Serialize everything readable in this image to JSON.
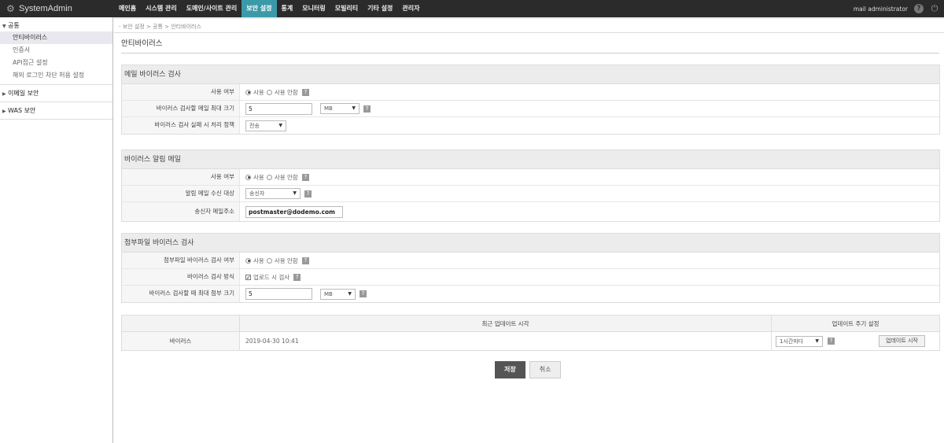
{
  "app": {
    "title": "SystemAdmin"
  },
  "topmenu": [
    "메인홈",
    "시스템 관리",
    "도메인/사이트 관리",
    "보안 설정",
    "통계",
    "모니터링",
    "모빌리티",
    "기타 설정",
    "관리자"
  ],
  "user": {
    "name": "mail administrator"
  },
  "sidebar": {
    "group1": {
      "label": "공통",
      "items": [
        "안티바이러스",
        "인증서",
        "API접근 설정",
        "해외 로그인 차단 허용 설정"
      ]
    },
    "group2": {
      "label": "이메일 보안"
    },
    "group3": {
      "label": "WAS 보안"
    }
  },
  "breadcrumb": "- 보안 설정 > 공통 > 안티바이러스",
  "page_title": "안티바이러스",
  "sec1": {
    "title": "메일 바이러스 검사",
    "r1": {
      "label": "사용 여부",
      "on": "사용",
      "off": "사용 안함"
    },
    "r2": {
      "label": "바이러스 검사할 메일 최대 크기",
      "value": "5",
      "unit": "MB"
    },
    "r3": {
      "label": "바이러스 검사 실패 시 처리 정책",
      "value": "전송"
    }
  },
  "sec2": {
    "title": "바이러스 알림 메일",
    "r1": {
      "label": "사용 여부",
      "on": "사용",
      "off": "사용 안함"
    },
    "r2": {
      "label": "알림 메일 수신 대상",
      "value": "송신자"
    },
    "r3": {
      "label": "송신자 메일주소",
      "value": "postmaster@dodemo.com"
    }
  },
  "sec3": {
    "title": "첨부파일 바이러스 검사",
    "r1": {
      "label": "첨부파일 바이러스 검사 여부",
      "on": "사용",
      "off": "사용 안함"
    },
    "r2": {
      "label": "바이러스 검사 방식",
      "value": "업로드 시 검사"
    },
    "r3": {
      "label": "바이러스 검사할 때 최대 첨부 크기",
      "value": "5",
      "unit": "MB"
    }
  },
  "update": {
    "h_time": "최근 업데이트 시각",
    "h_cycle": "업데이트 주기 설정",
    "row_label": "바이러스",
    "time": "2019-04-30 10:41",
    "cycle": "1시간마다",
    "start": "업데이트 시작"
  },
  "buttons": {
    "save": "저장",
    "cancel": "취소"
  }
}
